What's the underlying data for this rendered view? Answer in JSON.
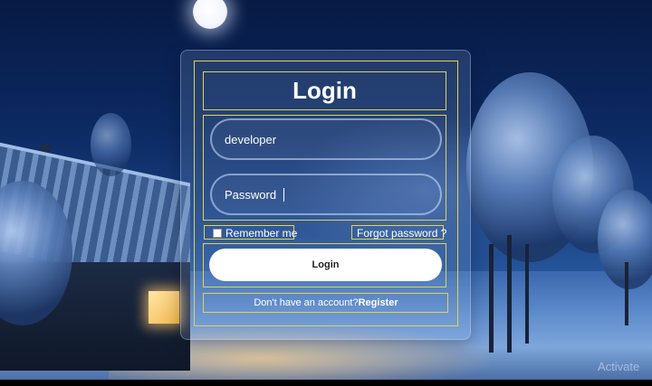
{
  "form": {
    "title": "Login",
    "username_value": "developer",
    "password_placeholder": "Password",
    "remember_label": "Remember me",
    "forgot_label": "Forgot password ?",
    "login_button": "Login",
    "register_prompt": "Don't have an account?",
    "register_link": "Register"
  },
  "watermark": "Activate",
  "colors": {
    "highlight_box": "#e2d34b",
    "button_bg": "#ffffff",
    "sky": "#0d2a63"
  },
  "icons": [
    "moon-icon"
  ]
}
